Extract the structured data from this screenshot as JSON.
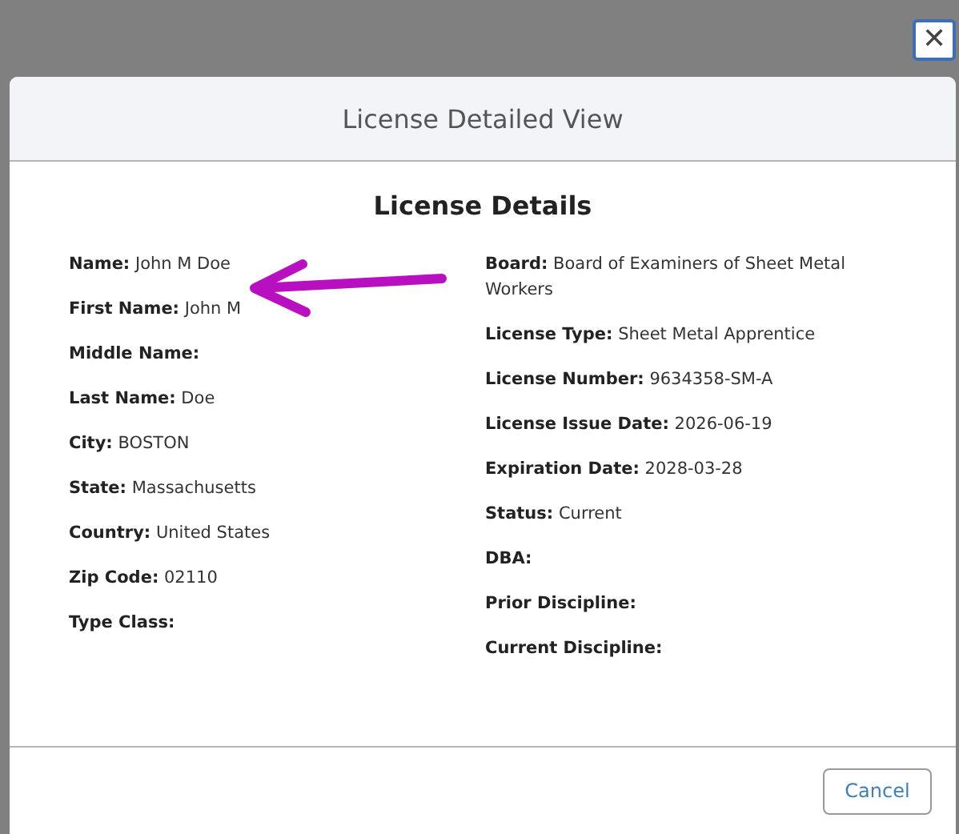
{
  "close_button": {
    "label": "✕"
  },
  "dialog": {
    "title": "License Detailed View",
    "heading": "License Details",
    "left_fields": [
      "**Name:** John M Doe",
      "**First Name:** John M",
      "**Middle Name:**",
      "**Last Name:** Doe",
      "**City:** BOSTON",
      "**State:** Massachusetts",
      "**Country:** United States",
      "**Zip Code:** 02110",
      "**Type Class:**"
    ],
    "right_fields": [
      "**Board:** Board of Examiners of Sheet Metal Workers",
      "**License Type:** Sheet Metal Apprentice",
      "**License Number:** 9634358-SM-A",
      "**License Issue Date:** 2026-06-19",
      "**Expiration Date:** 2028-03-28",
      "**Status:** Current",
      "**DBA:**",
      "**Prior Discipline:**",
      "**Current Discipline:**"
    ],
    "buttons": [
      "Cancel"
    ]
  }
}
